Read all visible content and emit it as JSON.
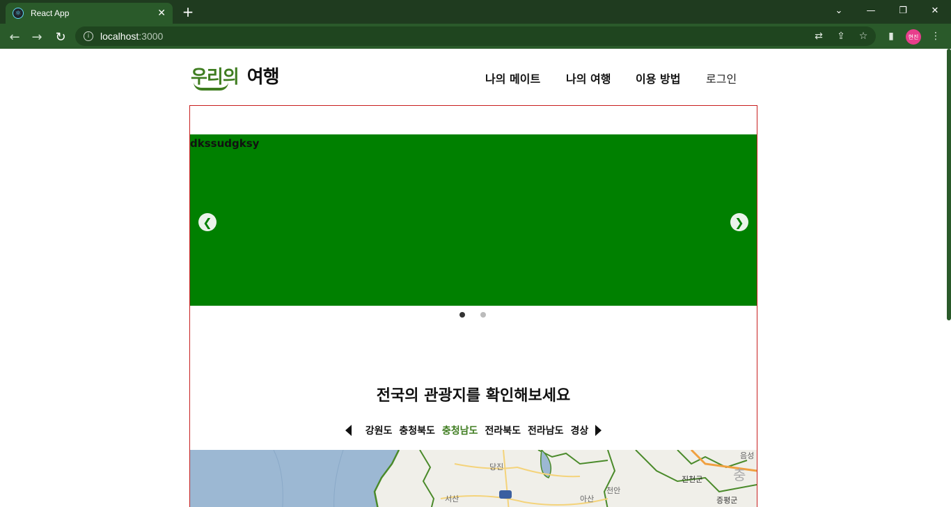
{
  "browser": {
    "tab_title": "React App",
    "url_host": "localhost",
    "url_port": ":3000",
    "profile_initials": "현진"
  },
  "header": {
    "logo_part1": "우리의",
    "logo_part2": "여행",
    "nav": [
      {
        "label": "나의 메이트"
      },
      {
        "label": "나의 여행"
      },
      {
        "label": "이용 방법"
      },
      {
        "label": "로그인"
      }
    ]
  },
  "carousel": {
    "slide_text": "dkssudgksy",
    "slide_color": "#008000",
    "slide_count": 2,
    "active_index": 0
  },
  "attractions": {
    "title": "전국의 관광지를 확인해보세요",
    "regions": [
      {
        "label": "강원도"
      },
      {
        "label": "충청북도"
      },
      {
        "label": "충청남도",
        "active": true
      },
      {
        "label": "전라북도"
      },
      {
        "label": "전라남도"
      },
      {
        "label": "경상"
      }
    ],
    "active_color": "#3f7d20"
  },
  "map": {
    "labels": [
      "당진",
      "서산",
      "아산",
      "천안",
      "진천군",
      "증평군",
      "음성",
      "충"
    ]
  },
  "icons": {
    "favicon": "react-icon",
    "prev": "chevron-left-circle-icon",
    "next": "chevron-right-circle-icon"
  }
}
